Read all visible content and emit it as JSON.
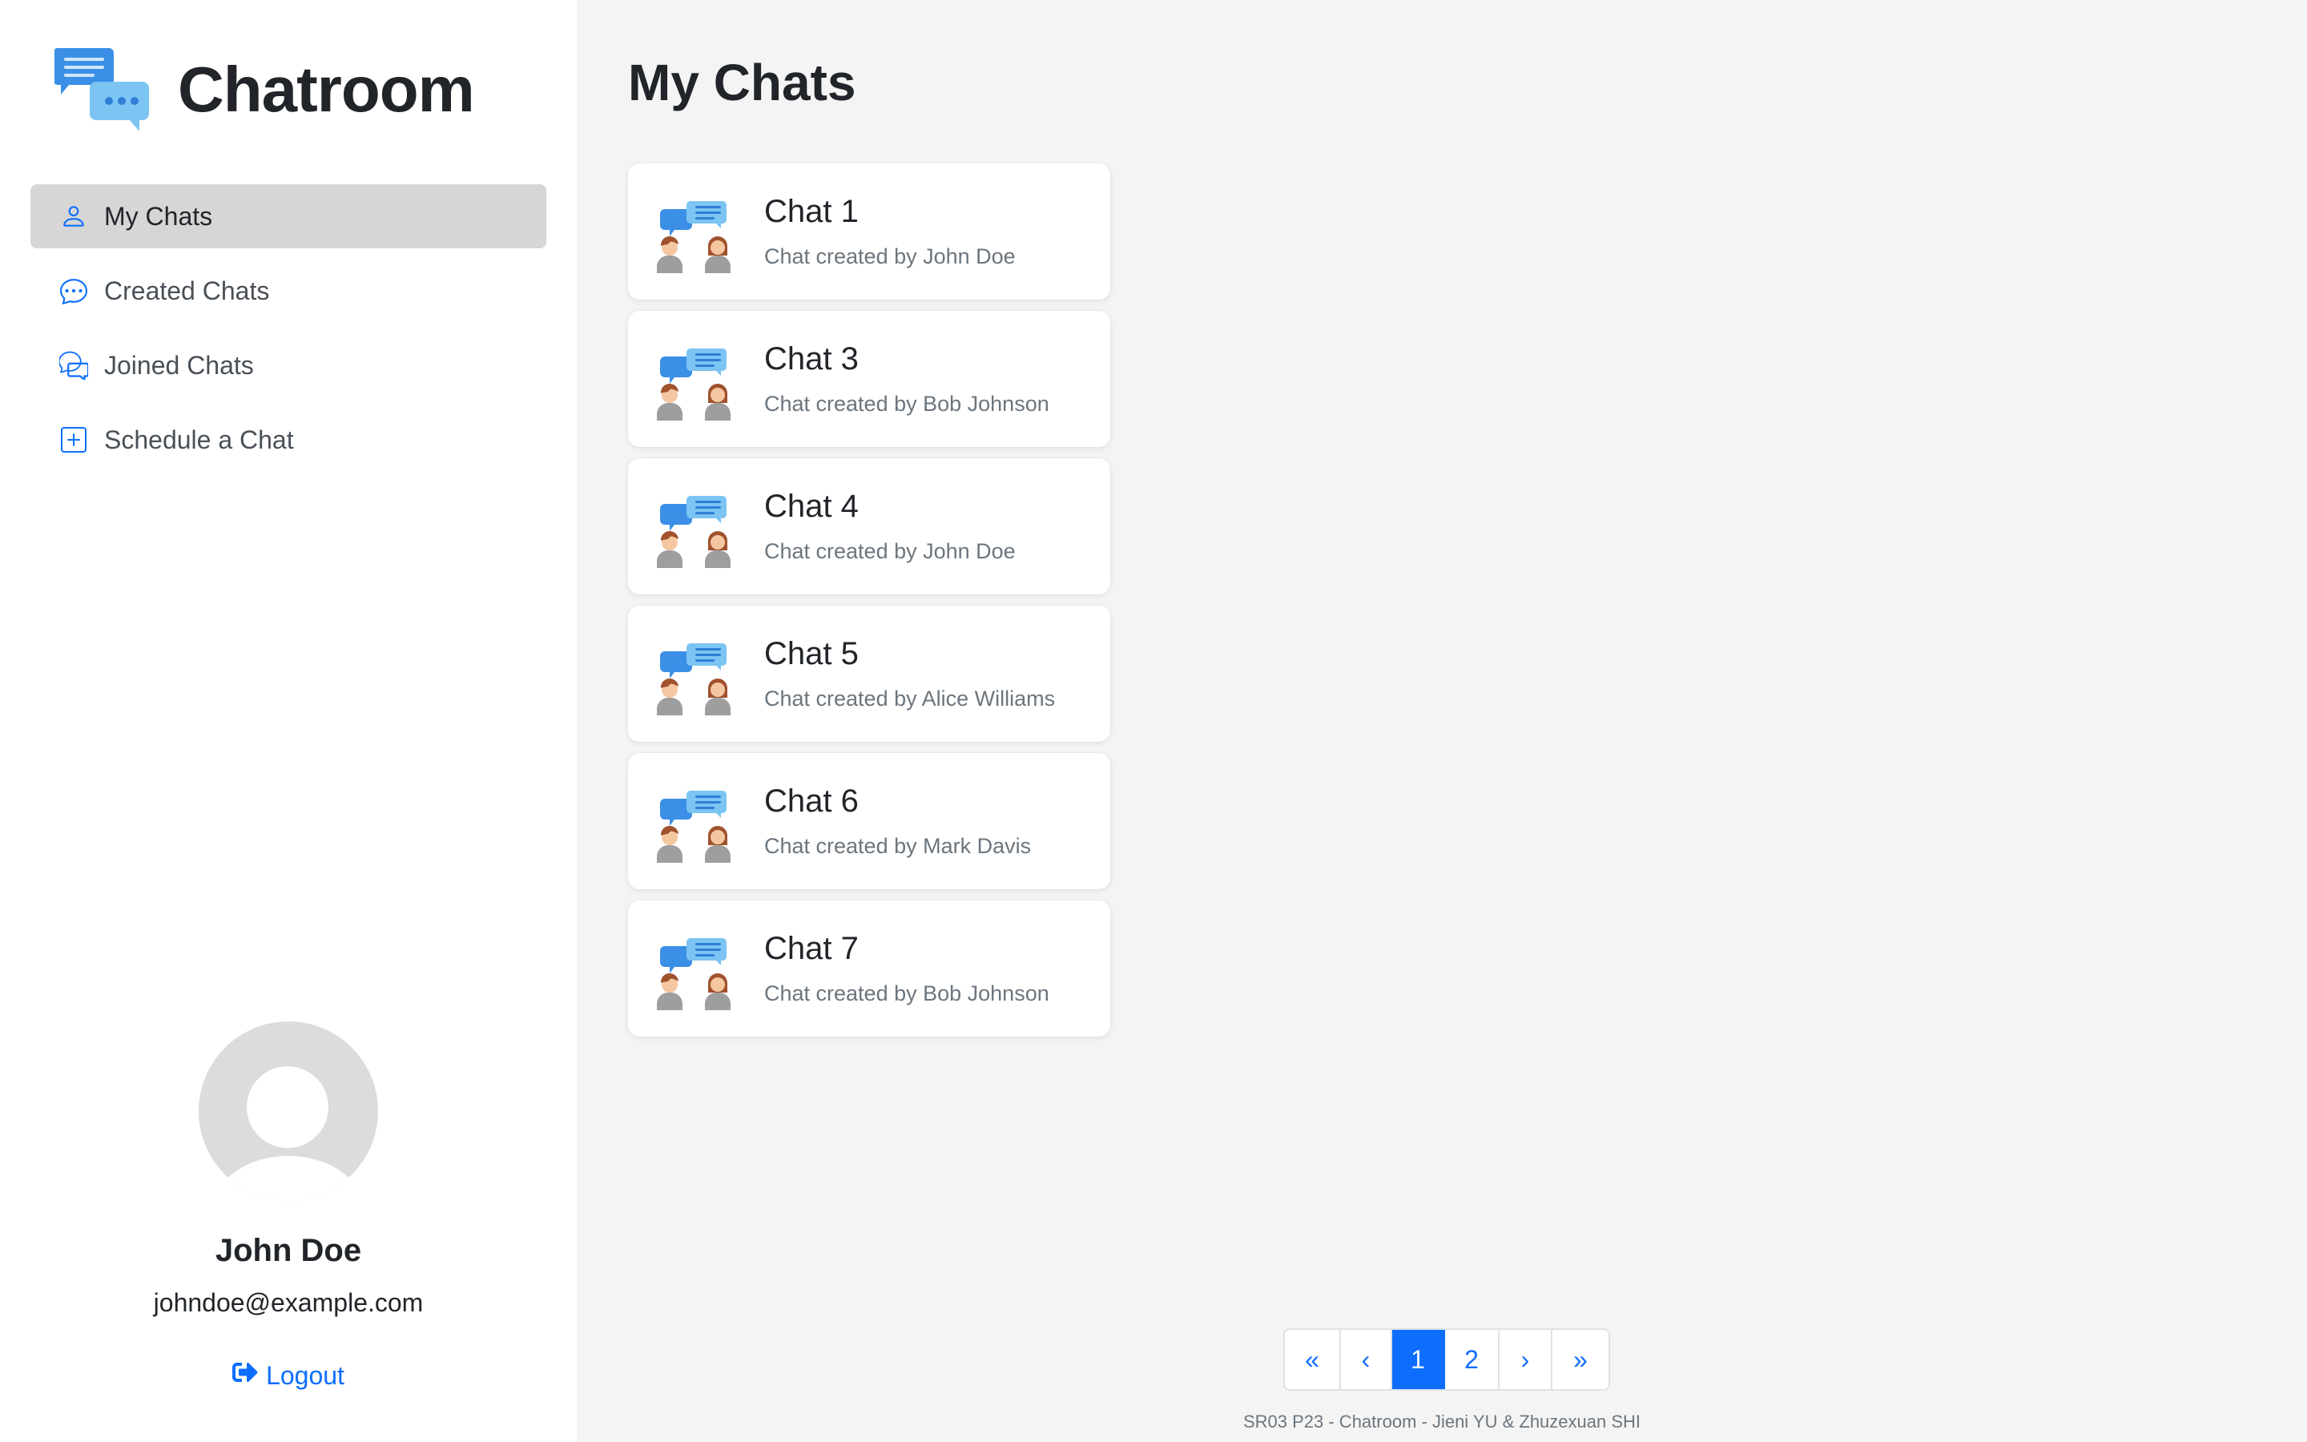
{
  "brand": {
    "title": "Chatroom",
    "logo_icon": "chat-bubbles-icon"
  },
  "colors": {
    "accent": "#0d6efd",
    "sidebar_active": "#d6d6d6",
    "background": "#f4f4f4",
    "icon_blue": "#3b8fe6",
    "icon_light_blue": "#7cc4f2"
  },
  "nav": {
    "items": [
      {
        "label": "My Chats",
        "icon": "person-icon",
        "active": true
      },
      {
        "label": "Created Chats",
        "icon": "chat-dots-icon",
        "active": false
      },
      {
        "label": "Joined Chats",
        "icon": "chats-icon",
        "active": false
      },
      {
        "label": "Schedule a Chat",
        "icon": "plus-square-icon",
        "active": false
      }
    ]
  },
  "profile": {
    "name": "John Doe",
    "email": "johndoe@example.com",
    "logout_label": "Logout"
  },
  "main": {
    "title": "My Chats",
    "chats": [
      {
        "title": "Chat 1",
        "subtitle": "Chat created by John Doe"
      },
      {
        "title": "Chat 3",
        "subtitle": "Chat created by Bob Johnson"
      },
      {
        "title": "Chat 4",
        "subtitle": "Chat created by John Doe"
      },
      {
        "title": "Chat 5",
        "subtitle": "Chat created by Alice Williams"
      },
      {
        "title": "Chat 6",
        "subtitle": "Chat created by Mark Davis"
      },
      {
        "title": "Chat 7",
        "subtitle": "Chat created by Bob Johnson"
      }
    ]
  },
  "pagination": {
    "first": "«",
    "prev": "‹",
    "pages": [
      "1",
      "2"
    ],
    "current": "1",
    "next": "›",
    "last": "»"
  },
  "footer": {
    "text": "SR03 P23 - Chatroom - Jieni YU & Zhuzexuan SHI"
  }
}
